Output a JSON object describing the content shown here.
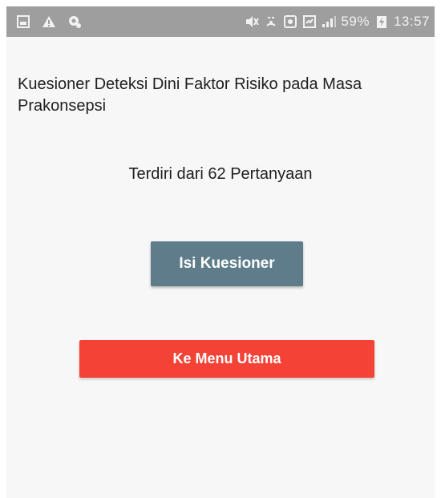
{
  "status_bar": {
    "icons_left": [
      "gallery-icon",
      "warning-icon",
      "settings-icon"
    ],
    "icons_right": [
      "mute-icon",
      "hotspot-icon",
      "screenshot-icon",
      "sim-icon",
      "signal-icon"
    ],
    "battery_percent": "59%",
    "time": "13:57"
  },
  "screen": {
    "title": "Kuesioner Deteksi Dini Faktor Risiko pada Masa Prakonsepsi",
    "subtitle": "Terdiri dari 62 Pertanyaan",
    "fill_button_label": "Isi Kuesioner",
    "main_menu_button_label": "Ke Menu Utama"
  },
  "colors": {
    "status_bar": "#9e9e9e",
    "background": "#f7f7f7",
    "primary_button": "#5f7c8a",
    "danger_button": "#f44336"
  }
}
